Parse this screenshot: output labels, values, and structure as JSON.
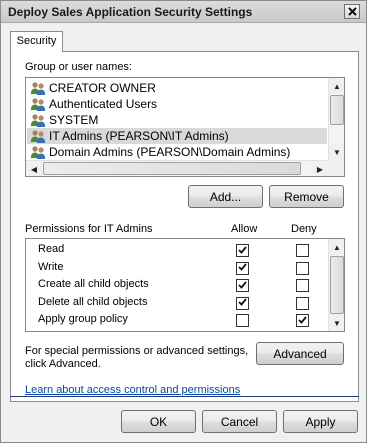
{
  "window": {
    "title": "Deploy Sales Application Security Settings"
  },
  "tabs": [
    {
      "label": "Security"
    }
  ],
  "users_section": {
    "label": "Group or user names:",
    "users": [
      {
        "name": "CREATOR OWNER",
        "icon": "user-group-icon"
      },
      {
        "name": "Authenticated Users",
        "icon": "user-group-icon"
      },
      {
        "name": "SYSTEM",
        "icon": "user-group-icon"
      },
      {
        "name": "IT Admins (PEARSON\\IT Admins)",
        "icon": "user-group-icon"
      },
      {
        "name": "Domain Admins (PEARSON\\Domain Admins)",
        "icon": "user-group-icon"
      }
    ],
    "selected_index": 3,
    "add_label": "Add...",
    "remove_label": "Remove"
  },
  "permissions_section": {
    "label": "Permissions for IT Admins",
    "allow_header": "Allow",
    "deny_header": "Deny",
    "rows": [
      {
        "name": "Read",
        "allow": true,
        "deny": false
      },
      {
        "name": "Write",
        "allow": true,
        "deny": false
      },
      {
        "name": "Create all child objects",
        "allow": true,
        "deny": false
      },
      {
        "name": "Delete all child objects",
        "allow": true,
        "deny": false
      },
      {
        "name": "Apply group policy",
        "allow": false,
        "deny": true
      }
    ]
  },
  "advanced_section": {
    "line1": "For special permissions or advanced settings,",
    "line2": "click Advanced.",
    "button_label": "Advanced"
  },
  "help_link": "Learn about access control and permissions",
  "footer": {
    "ok_label": "OK",
    "cancel_label": "Cancel",
    "apply_label": "Apply"
  }
}
